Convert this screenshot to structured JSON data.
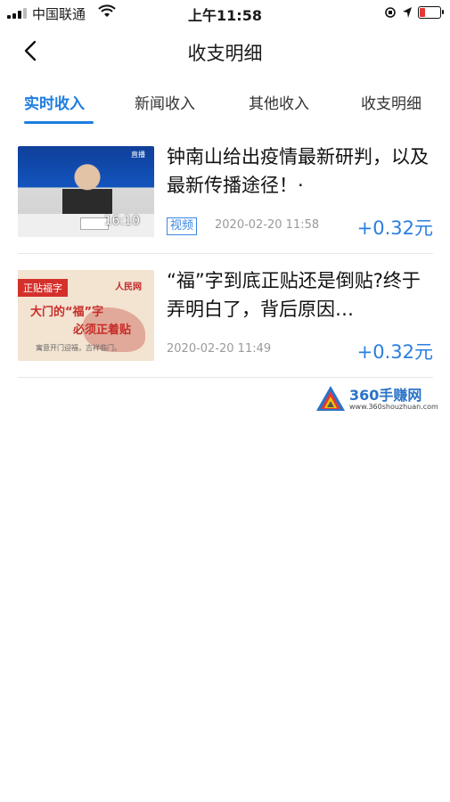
{
  "status_bar": {
    "carrier": "中国联通",
    "time": "上午11:58",
    "battery_color": "#e53935"
  },
  "nav": {
    "back_icon": "chevron-left-icon",
    "title": "收支明细"
  },
  "tabs": [
    {
      "label": "实时收入",
      "active": true
    },
    {
      "label": "新闻收入",
      "active": false
    },
    {
      "label": "其他收入",
      "active": false
    },
    {
      "label": "收支明细",
      "active": false
    }
  ],
  "items": [
    {
      "title": "钟南山给出疫情最新研判，以及最新传播途径！·",
      "tag": "视频",
      "datetime": "2020-02-20 11:58",
      "amount": "+0.32元",
      "thumb_duration": "16:10"
    },
    {
      "title": "“福”字到底正贴还是倒贴?终于弄明白了，背后原因…",
      "tag": "",
      "datetime": "2020-02-20 11:49",
      "amount": "+0.32元",
      "thumb_ribbon": "正贴福字",
      "thumb_line1": "大门的“福”字",
      "thumb_line2": "必须正着贴",
      "thumb_line3": "寓意开门迎福，吉祥临门。"
    }
  ],
  "watermark": {
    "name": "360手赚网",
    "url": "www.360shouzhuan.com"
  },
  "colors": {
    "accent": "#1e7de0",
    "amount": "#2a7fe0"
  }
}
